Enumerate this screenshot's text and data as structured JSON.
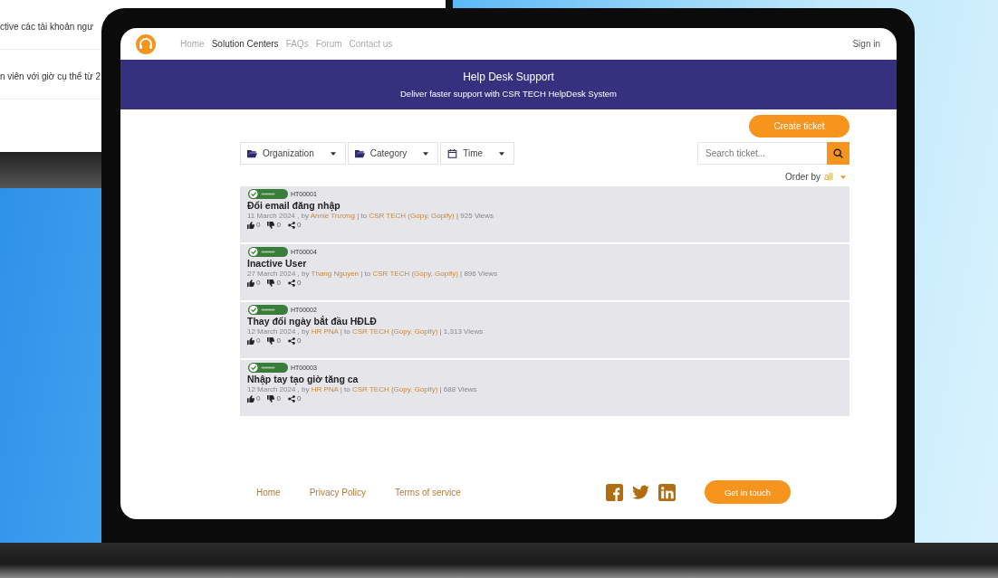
{
  "background_window": {
    "lines": [
      "ctive các tài khoản ngư",
      "n viên với giờ cụ thể từ 2"
    ]
  },
  "nav": {
    "links": [
      {
        "label": "Home",
        "selected": false
      },
      {
        "label": "Solution Centers",
        "selected": true
      },
      {
        "label": "FAQs",
        "selected": false
      },
      {
        "label": "Forum",
        "selected": false
      },
      {
        "label": "Contact us",
        "selected": false
      }
    ],
    "sign_in": "Sign in"
  },
  "banner": {
    "title": "Help Desk Support",
    "subtitle": "Deliver faster support with CSR TECH HelpDesk System"
  },
  "create_button": "Create ticket",
  "filters": [
    {
      "label": "Organization",
      "kind": "folder"
    },
    {
      "label": "Category",
      "kind": "folder"
    },
    {
      "label": "Time",
      "kind": "calendar"
    }
  ],
  "search": {
    "placeholder": "Search ticket..."
  },
  "order_by": {
    "label": "Order by",
    "value": "all"
  },
  "tickets": [
    {
      "id": "HT00001",
      "title": "Đổi email đăng nhập",
      "meta_prefix": "11 March 2024 , by",
      "author": "Annie Trương",
      "meta_middle": "| to",
      "team": "CSR TECH (Gopy, Gopify)",
      "meta_suffix": "| 925 Views",
      "likes": "0",
      "dislikes": "0",
      "shares": "0"
    },
    {
      "id": "HT00004",
      "title": "Inactive User",
      "meta_prefix": "27 March 2024 , by",
      "author": "Thang Nguyen",
      "meta_middle": "| to",
      "team": "CSR TECH (Gopy, Gopify)",
      "meta_suffix": "| 896 Views",
      "likes": "0",
      "dislikes": "0",
      "shares": "0"
    },
    {
      "id": "HT00002",
      "title": "Thay đổi ngày bắt đầu HĐLĐ",
      "meta_prefix": "12 March 2024 , by",
      "author": "HR PNA",
      "meta_middle": "| to",
      "team": "CSR TECH (Gopy, Gopify)",
      "meta_suffix": "| 1,313 Views",
      "likes": "0",
      "dislikes": "0",
      "shares": "0"
    },
    {
      "id": "HT00003",
      "title": "Nhập tay tạo giờ tăng ca",
      "meta_prefix": "12 March 2024 , by",
      "author": "HR PNA",
      "meta_middle": "| to",
      "team": "CSR TECH (Gopy, Gopify)",
      "meta_suffix": "| 688 Views",
      "likes": "0",
      "dislikes": "0",
      "shares": "0"
    }
  ],
  "footer": {
    "links": [
      "Home",
      "Privacy Policy",
      "Terms of service"
    ],
    "button": "Get in touch"
  }
}
